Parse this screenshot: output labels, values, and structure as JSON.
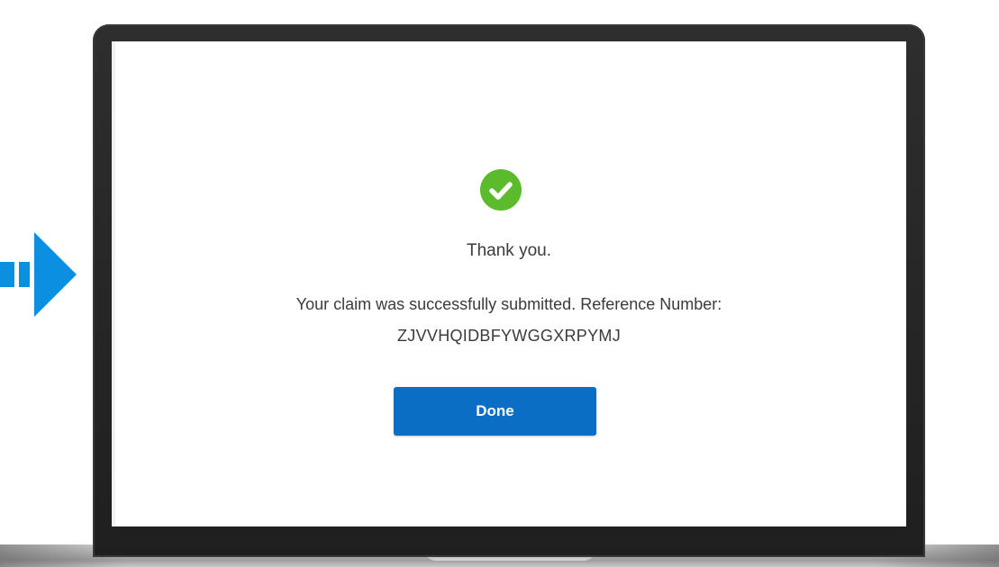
{
  "confirmation": {
    "icon": "check-circle-icon",
    "icon_color": "#5cbb2c",
    "title": "Thank you.",
    "message": "Your claim was successfully submitted. Reference Number:",
    "reference_number": "ZJVVHQIDBFYWGGXRPYMJ",
    "done_label": "Done",
    "button_color": "#0b6ec5"
  },
  "decoration": {
    "arrow_icon": "arrow-right-icon",
    "arrow_color": "#0b8fe0"
  }
}
